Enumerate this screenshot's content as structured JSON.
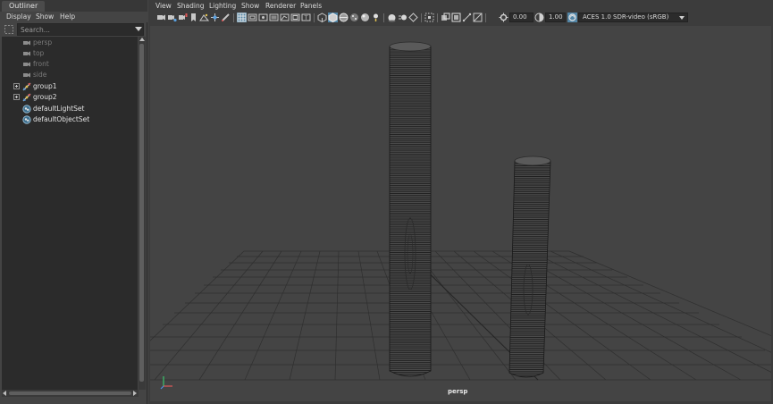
{
  "outliner": {
    "tab_title": "Outliner",
    "menus": [
      "Display",
      "Show",
      "Help"
    ],
    "search_placeholder": "Search...",
    "items": [
      {
        "label": "persp",
        "type": "camera",
        "dim": true,
        "expandable": false
      },
      {
        "label": "top",
        "type": "camera",
        "dim": true,
        "expandable": false
      },
      {
        "label": "front",
        "type": "camera",
        "dim": true,
        "expandable": false
      },
      {
        "label": "side",
        "type": "camera",
        "dim": true,
        "expandable": false
      },
      {
        "label": "group1",
        "type": "group",
        "dim": false,
        "expandable": true
      },
      {
        "label": "group2",
        "type": "group",
        "dim": false,
        "expandable": true
      },
      {
        "label": "defaultLightSet",
        "type": "set",
        "dim": false,
        "expandable": false
      },
      {
        "label": "defaultObjectSet",
        "type": "set",
        "dim": false,
        "expandable": false
      }
    ]
  },
  "viewport": {
    "menus": [
      "View",
      "Shading",
      "Lighting",
      "Show",
      "Renderer",
      "Panels"
    ],
    "exposure_value": "0.00",
    "gamma_value": "1.00",
    "color_transform": "ACES 1.0 SDR-video (sRGB)",
    "camera_label": "persp",
    "toolbar_icons": [
      "select-camera-icon",
      "camera-attributes-icon",
      "bookmarks-icon",
      "bookmark-flag-icon",
      "image-plane-icon",
      "two-d-pan-zoom-icon",
      "grease-pencil-icon",
      "grid-icon",
      "film-gate-icon",
      "resolution-gate-icon",
      "gate-mask-icon",
      "field-chart-icon",
      "safe-action-icon",
      "safe-title-icon",
      "wireframe-icon",
      "smooth-shade-icon",
      "wireframe-on-shaded-icon",
      "textured-icon",
      "use-all-lights-icon",
      "shadows-icon",
      "screen-space-ambient-occlusion-icon",
      "motion-blur-icon",
      "multisample-aa-icon",
      "isolate-select-icon",
      "xray-icon",
      "xray-active-components-icon",
      "xray-joints-icon",
      "backface-culling-icon",
      "exposure-icon",
      "gamma-icon",
      "color-management-icon"
    ]
  },
  "colors": {
    "panel_bg": "#444444",
    "tree_bg": "#2b2b2b",
    "selected_toolbar_icon": "#5285a6",
    "grid_line": "#2c2c2c",
    "mesh_line": "#1e1e1e"
  }
}
